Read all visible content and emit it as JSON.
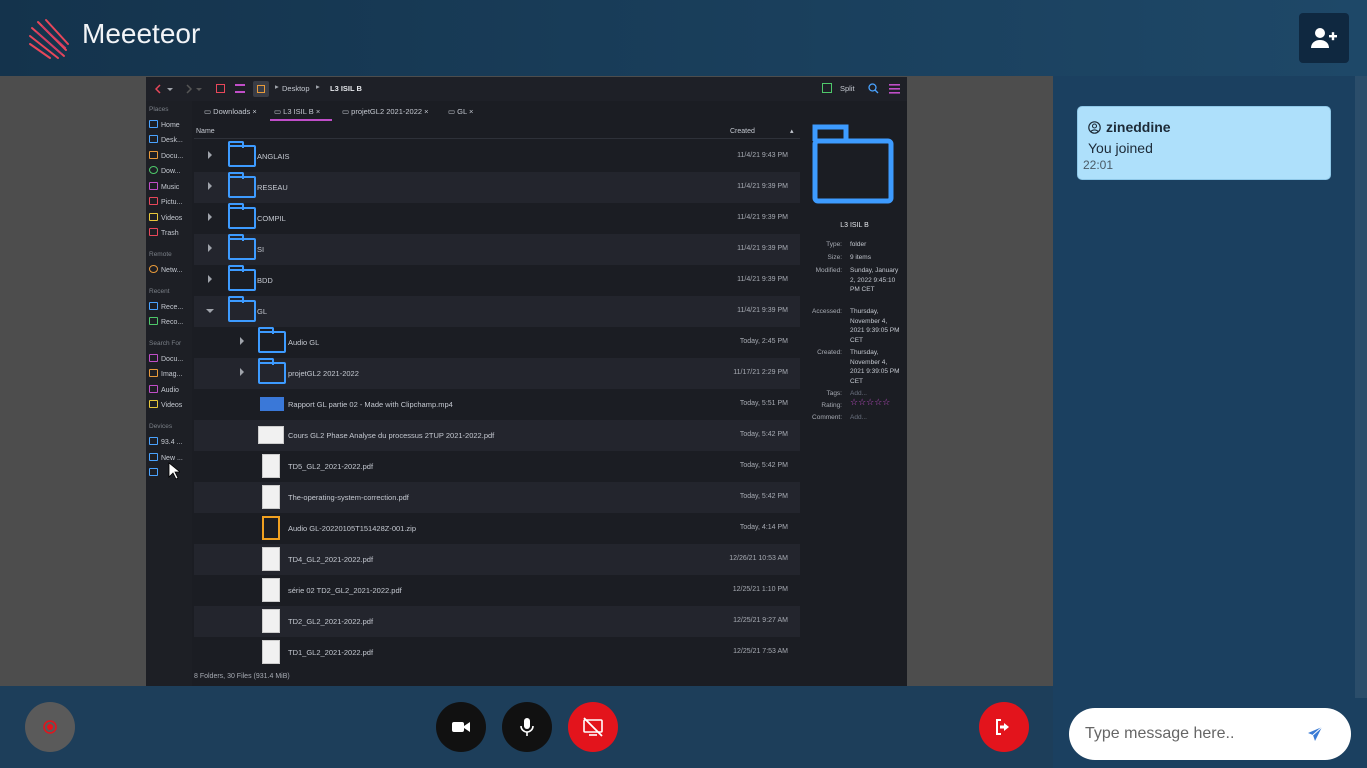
{
  "app": {
    "title": "Meeeteor",
    "invite_icon": "user-plus-icon"
  },
  "colors": {
    "accent_red": "#e3141c",
    "bubble": "#aee0fb",
    "folder_blue": "#3d9bff"
  },
  "chat": {
    "messages": [
      {
        "user": "zineddine",
        "text": "You joined",
        "time": "22:01"
      }
    ],
    "input_placeholder": "Type message here.."
  },
  "controls": {
    "record": "record-icon",
    "camera": "camera-icon",
    "mic": "microphone-icon",
    "screen_share": "screen-share-off-icon",
    "leave": "leave-icon"
  },
  "share": {
    "breadcrumb": [
      "Desktop",
      "L3 ISIL B"
    ],
    "split_label": "Split",
    "places_header": "Places",
    "places": [
      "Home",
      "Desk...",
      "Docu...",
      "Dow...",
      "Music",
      "Pictu...",
      "Videos",
      "Trash"
    ],
    "remote_header": "Remote",
    "remote": [
      "Netw..."
    ],
    "recent_header": "Recent",
    "recent": [
      "Rece...",
      "Reco..."
    ],
    "search_header": "Search For",
    "search": [
      "Docu...",
      "Imag...",
      "Audio",
      "Videos"
    ],
    "devices_header": "Devices",
    "devices": [
      "93.4 ...",
      "New ..."
    ],
    "tabs": [
      "Downloads",
      "L3 ISIL B",
      "projetGL2 2021-2022",
      "GL"
    ],
    "col_name": "Name",
    "col_created": "Created",
    "rows": [
      {
        "name": "ANGLAIS",
        "date": "11/4/21 9:43 PM"
      },
      {
        "name": "RESEAU",
        "date": "11/4/21 9:39 PM"
      },
      {
        "name": "COMPIL",
        "date": "11/4/21 9:39 PM"
      },
      {
        "name": "SI",
        "date": "11/4/21 9:39 PM"
      },
      {
        "name": "BDD",
        "date": "11/4/21 9:39 PM"
      },
      {
        "name": "GL",
        "date": "11/4/21 9:39 PM"
      },
      {
        "name": "Audio GL",
        "date": "Today, 2:45 PM"
      },
      {
        "name": "projetGL2 2021-2022",
        "date": "11/17/21 2:29 PM"
      },
      {
        "name": "Rapport GL partie 02 - Made with Clipchamp.mp4",
        "date": "Today, 5:51 PM"
      },
      {
        "name": "Cours GL2 Phase Analyse du processus 2TUP 2021-2022.pdf",
        "date": "Today, 5:42 PM"
      },
      {
        "name": "TD5_GL2_2021-2022.pdf",
        "date": "Today, 5:42 PM"
      },
      {
        "name": "The-operating-system-correction.pdf",
        "date": "Today, 5:42 PM"
      },
      {
        "name": "Audio GL-20220105T151428Z-001.zip",
        "date": "Today, 4:14 PM"
      },
      {
        "name": "TD4_GL2_2021-2022.pdf",
        "date": "12/26/21 10:53 AM"
      },
      {
        "name": "série 02 TD2_GL2_2021-2022.pdf",
        "date": "12/25/21 1:10 PM"
      },
      {
        "name": "TD2_GL2_2021-2022.pdf",
        "date": "12/25/21 9:27 AM"
      },
      {
        "name": "TD1_GL2_2021-2022.pdf",
        "date": "12/25/21 7:53 AM"
      }
    ],
    "status": "8 Folders, 30 Files (931.4 MiB)",
    "info": {
      "name": "L3 ISIL B",
      "type_k": "Type:",
      "type_v": "folder",
      "size_k": "Size:",
      "size_v": "9 items",
      "modified_k": "Modified:",
      "modified_v": "Sunday, January 2, 2022 9:45:10 PM CET",
      "accessed_k": "Accessed:",
      "accessed_v": "Thursday, November 4, 2021 9:39:05 PM CET",
      "created_k": "Created:",
      "created_v": "Thursday, November 4, 2021 9:39:05 PM CET",
      "tags_k": "Tags:",
      "tags_v": "Add...",
      "rating_k": "Rating:",
      "rating_v": "☆☆☆☆☆",
      "comment_k": "Comment:",
      "comment_v": "Add..."
    }
  }
}
